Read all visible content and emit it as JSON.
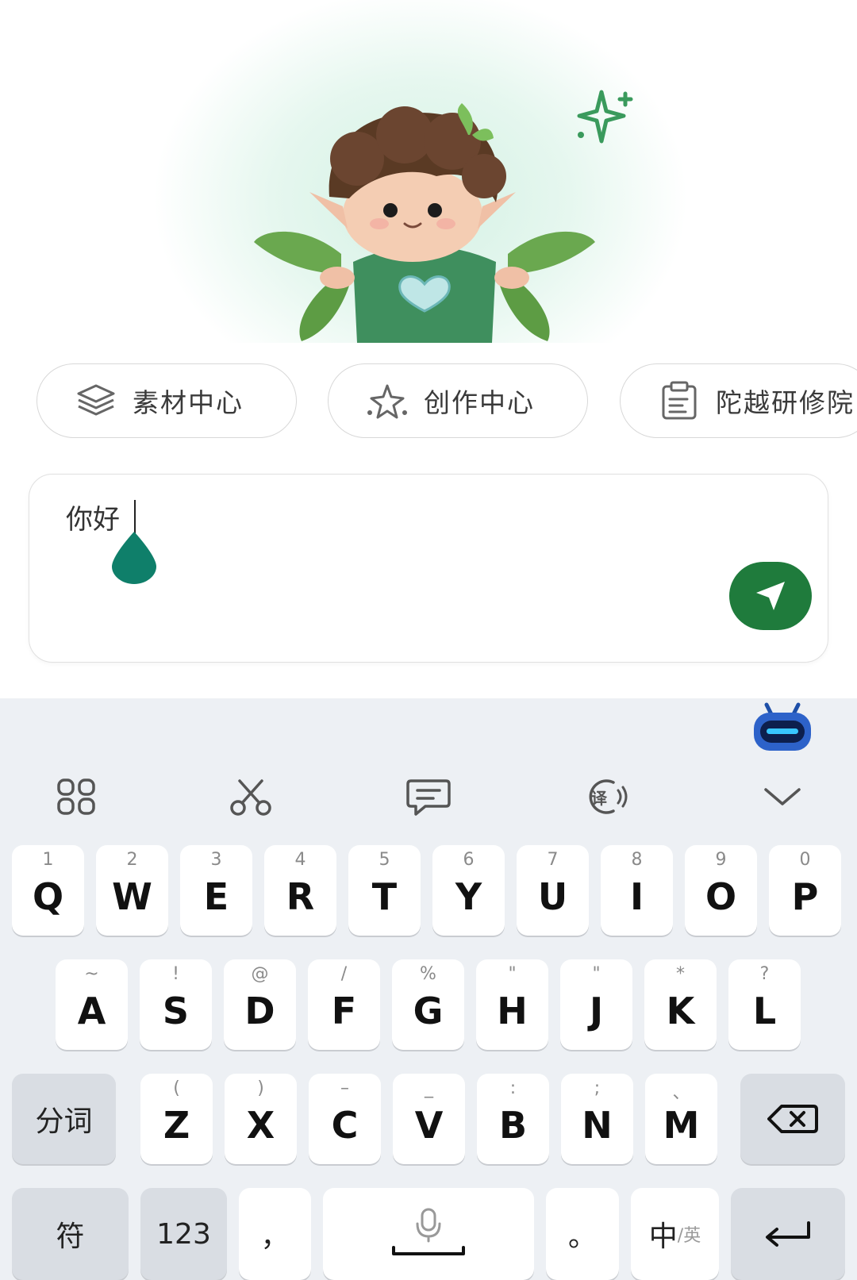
{
  "hero": {
    "sparkle_icon": "sparkle-icon",
    "mascot": "leaf-sprite-mascot"
  },
  "chips": [
    {
      "label": "素材中心",
      "icon": "layers-icon"
    },
    {
      "label": "创作中心",
      "icon": "sparkle-star-icon"
    },
    {
      "label": "陀越研修院",
      "icon": "clipboard-icon"
    }
  ],
  "input": {
    "value": "你好",
    "send_icon": "send-icon",
    "accent": "#1f7b3c"
  },
  "keyboard": {
    "assistant_icon": "robot-assistant-icon",
    "toolbar": [
      "apps-grid-icon",
      "scissors-icon",
      "chat-bubble-icon",
      "translate-icon",
      "collapse-chevron-icon"
    ],
    "translate_glyph": "译",
    "row1": [
      {
        "hint": "1",
        "key": "Q"
      },
      {
        "hint": "2",
        "key": "W"
      },
      {
        "hint": "3",
        "key": "E"
      },
      {
        "hint": "4",
        "key": "R"
      },
      {
        "hint": "5",
        "key": "T"
      },
      {
        "hint": "6",
        "key": "Y"
      },
      {
        "hint": "7",
        "key": "U"
      },
      {
        "hint": "8",
        "key": "I"
      },
      {
        "hint": "9",
        "key": "O"
      },
      {
        "hint": "0",
        "key": "P"
      }
    ],
    "row2": [
      {
        "hint": "~",
        "key": "A"
      },
      {
        "hint": "!",
        "key": "S"
      },
      {
        "hint": "@",
        "key": "D"
      },
      {
        "hint": "/",
        "key": "F"
      },
      {
        "hint": "%",
        "key": "G"
      },
      {
        "hint": "\"",
        "key": "H"
      },
      {
        "hint": "\"",
        "key": "J"
      },
      {
        "hint": "*",
        "key": "K"
      },
      {
        "hint": "?",
        "key": "L"
      }
    ],
    "row3": [
      {
        "hint": "(",
        "key": "Z"
      },
      {
        "hint": ")",
        "key": "X"
      },
      {
        "hint": "–",
        "key": "C"
      },
      {
        "hint": "_",
        "key": "V"
      },
      {
        "hint": ":",
        "key": "B"
      },
      {
        "hint": ";",
        "key": "N"
      },
      {
        "hint": "、",
        "key": "M"
      }
    ],
    "fenci": "分词",
    "backspace_icon": "backspace-icon",
    "fu": "符",
    "num": "123",
    "comma": "，",
    "space_icon": "microphone-icon",
    "period": "。",
    "lang_main": "中",
    "lang_sub": "/英",
    "enter_icon": "enter-icon"
  }
}
